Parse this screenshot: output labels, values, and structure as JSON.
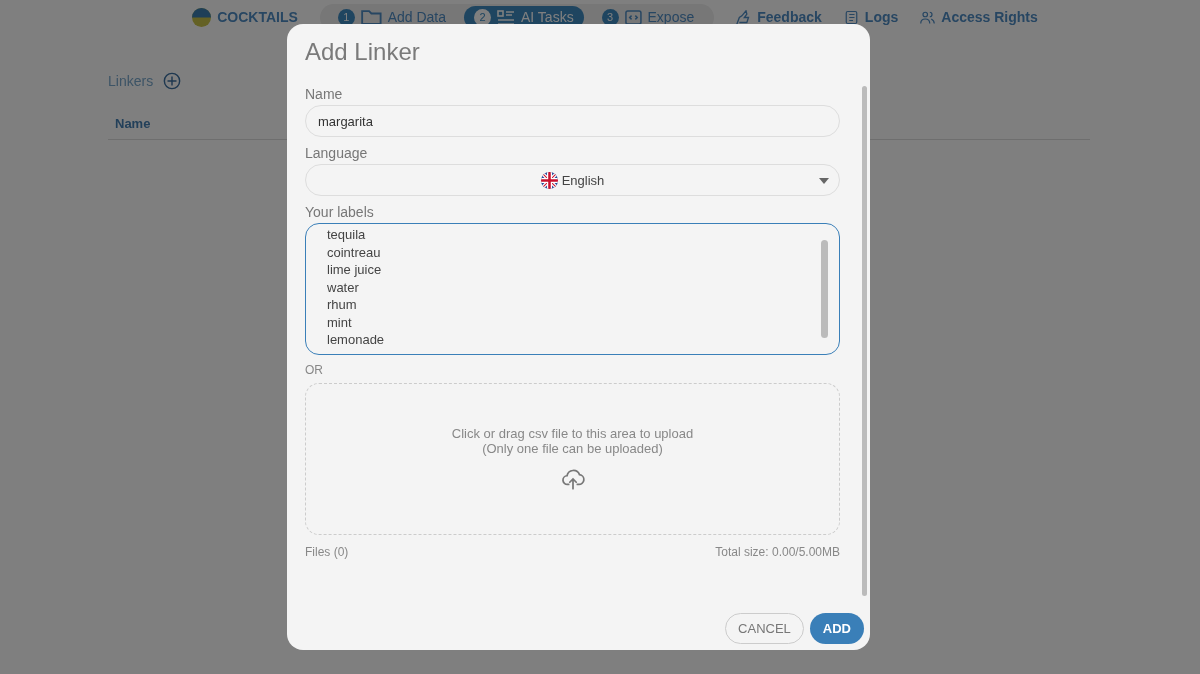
{
  "nav": {
    "project": "COCKTAILS",
    "steps": [
      {
        "number": "1",
        "label": "Add Data",
        "kind": "data",
        "selected": false
      },
      {
        "number": "2",
        "label": "AI Tasks",
        "kind": "tasks",
        "selected": true
      },
      {
        "number": "3",
        "label": "Expose",
        "kind": "expose",
        "selected": false
      }
    ],
    "links": [
      {
        "kind": "feedback",
        "label": "Feedback"
      },
      {
        "kind": "logs",
        "label": "Logs"
      },
      {
        "kind": "access",
        "label": "Access Rights"
      }
    ]
  },
  "page": {
    "section_title": "Linkers",
    "table": {
      "columns": [
        "Name"
      ]
    }
  },
  "dialog": {
    "title": "Add Linker",
    "name_field": {
      "label": "Name",
      "value": "margarita"
    },
    "language_field": {
      "label": "Language",
      "value": "English"
    },
    "labels_field": {
      "label": "Your labels",
      "lines": [
        "tequila",
        "cointreau",
        "lime juice",
        "water",
        "rhum",
        "mint",
        "lemonade"
      ]
    },
    "separator": "OR",
    "upload": {
      "hint": "Click or drag csv file to this area to upload",
      "note": "(Only one file can be uploaded)",
      "files": "Files (0)",
      "total": "Total size: 0.00/5.00MB"
    },
    "buttons": [
      {
        "kind": "secondary",
        "label": "CANCEL"
      },
      {
        "kind": "primary",
        "label": "ADD"
      }
    ]
  }
}
